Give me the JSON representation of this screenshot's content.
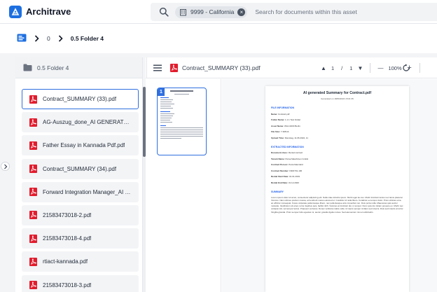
{
  "app": {
    "name": "Architrave",
    "brand_color": "#1d6fe0",
    "logo_icon": "architrave-logo-icon"
  },
  "search": {
    "icon": "search-icon",
    "scope_chip": {
      "icon": "building-icon",
      "label": "9999 - California",
      "close_icon": "close-icon"
    },
    "placeholder": "Search for documents within this asset"
  },
  "breadcrumb": {
    "icon": "folder-tree-icon",
    "items": [
      {
        "label": "0"
      },
      {
        "label": "0.5 Folder 4",
        "current": true
      }
    ]
  },
  "file_panel": {
    "folder_icon": "folder-icon",
    "title": "0.5 Folder 4",
    "files": [
      {
        "name": "Contract_SUMMARY (33).pdf",
        "active": true
      },
      {
        "name": "AG-Auszug_done_AI GENERATED SUMMARY.pdf"
      },
      {
        "name": "Father Essay in Kannada Pdf.pdf"
      },
      {
        "name": "Contract_SUMMARY (34).pdf"
      },
      {
        "name": "Forward Integration Manager_AI GENERATED SUMMARY.pdf"
      },
      {
        "name": "21583473018-2.pdf"
      },
      {
        "name": "21583473018-4.pdf"
      },
      {
        "name": "rtiact-kannada.pdf"
      },
      {
        "name": "21583473018-3.pdf"
      }
    ]
  },
  "viewer": {
    "filename": "Contract_SUMMARY (33).pdf",
    "page_current": "1",
    "page_separator": "/",
    "page_total": "1",
    "zoom": "100%",
    "accent_color": "#2f6fe0",
    "pdf_icon_color": "#e11d2e",
    "thumbnail_page_number": "1",
    "document": {
      "title": "AI generated Summary for Contract.pdf",
      "generated": "Generated on 18/06/2024 15:01:35",
      "sections": [
        {
          "heading": "FILE INFORMATION",
          "rows": [
            {
              "key": "Name:",
              "value": "Contract.pdf"
            },
            {
              "key": "Folder Name:",
              "value": "1.1.1 Test Folder"
            },
            {
              "key": "Asset Name:",
              "value": "WH-10230 Berlin"
            },
            {
              "key": "File Size:",
              "value": "7.398 kb"
            },
            {
              "key": "Upload Time:",
              "value": "Dienstag, 11.06.2024, 11"
            }
          ]
        },
        {
          "heading": "EXTRACTED INFORMATION",
          "rows": [
            {
              "key": "Document class:",
              "value": "Rental contract"
            },
            {
              "key": "Tenant Name:",
              "value": "Persa Maschinen GmbH"
            },
            {
              "key": "Contract Person:",
              "value": "Petra Mannfeld"
            },
            {
              "key": "Contract Number:",
              "value": "INR2701-100"
            },
            {
              "key": "Rental Start Date:",
              "value": "01.01.2019"
            },
            {
              "key": "Rental End Date:",
              "value": "31.12.2020"
            }
          ]
        }
      ],
      "summary_heading": "SUMMARY",
      "summary_text": "Lorem ipsum dolor sit amet, consectetur adipiscing elit. Nulla vitae lobortis ipsum. Morbi eget leo leo. Morbi tincidunt lectus nec lacus placerat rhoncus. Nam ultrices pretium massa, at hendrerit metus euismod ut. Curabitur id nulla libero. Curabitur eu tempor dolor. Proin ultricies urna ac efficitur consequat. Fusce vulputate pellentesque libero, nec pellentesque arcu imperdiet non. Duis porta nulla. Maecenas quis auctor molestie. Vestibulum sit amet, tortor dapibus quis, facilisi nibh. Vivamus at tincidunt dui, in tempor. Nunc quis dui. Etiam posuere ex. Morbi nec volutpat nisl, vel tempor lectus. Praesent vel lacus. Donec vehicula mattis nulla. Ut turpis semper id diam sed viverra. Duis sed mauris at tortor fringilla gravida. Proin semper felis egestas mi, auctor gravida ligula cursus. Sed elementum nisi et sollicitudin."
    }
  }
}
